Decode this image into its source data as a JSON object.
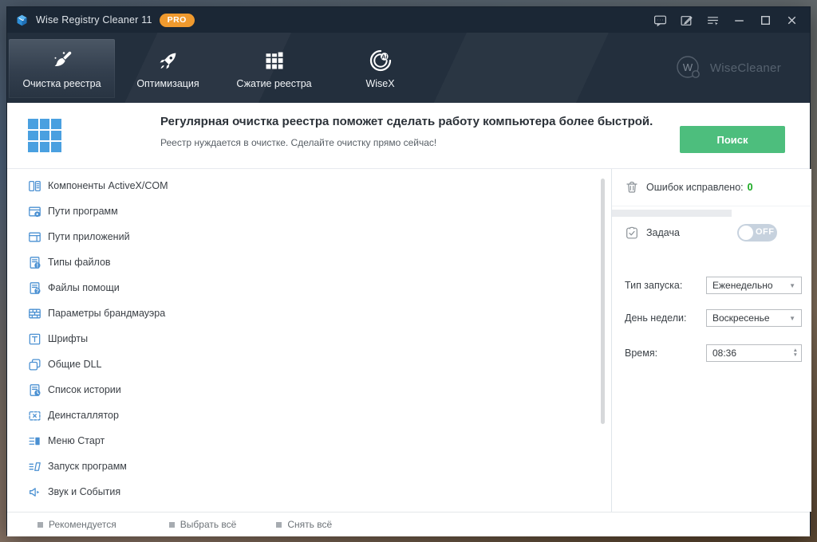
{
  "window": {
    "title": "Wise Registry Cleaner 11",
    "badge": "PRO"
  },
  "nav": {
    "tabs": [
      {
        "label": "Очистка реестра",
        "active": true
      },
      {
        "label": "Оптимизация",
        "active": false
      },
      {
        "label": "Сжатие реестра",
        "active": false
      },
      {
        "label": "WiseX",
        "active": false
      }
    ],
    "brand": "WiseCleaner"
  },
  "banner": {
    "title": "Регулярная очистка реестра поможет сделать работу компьютера более быстрой.",
    "subtitle": "Реестр нуждается в очистке. Сделайте очистку прямо сейчас!",
    "scan_button": "Поиск"
  },
  "list": {
    "items": [
      {
        "label": "Компоненты ActiveX/COM",
        "icon": "components-icon"
      },
      {
        "label": "Пути программ",
        "icon": "program-paths-icon"
      },
      {
        "label": "Пути приложений",
        "icon": "app-paths-icon"
      },
      {
        "label": "Типы файлов",
        "icon": "file-types-icon"
      },
      {
        "label": "Файлы помощи",
        "icon": "help-files-icon"
      },
      {
        "label": "Параметры брандмауэра",
        "icon": "firewall-icon"
      },
      {
        "label": "Шрифты",
        "icon": "fonts-icon"
      },
      {
        "label": "Общие DLL",
        "icon": "shared-dll-icon"
      },
      {
        "label": "Список истории",
        "icon": "history-icon"
      },
      {
        "label": "Деинсталлятор",
        "icon": "uninstaller-icon"
      },
      {
        "label": "Меню Старт",
        "icon": "start-menu-icon"
      },
      {
        "label": "Запуск программ",
        "icon": "startup-icon"
      },
      {
        "label": "Звук и События",
        "icon": "sound-icon"
      }
    ]
  },
  "panel": {
    "fixed_label": "Ошибок исправлено:",
    "fixed_value": "0",
    "task_label": "Задача",
    "toggle_state": "OFF",
    "fields": [
      {
        "label": "Тип запуска:",
        "value": "Еженедельно"
      },
      {
        "label": "День недели:",
        "value": "Воскресенье"
      },
      {
        "label": "Время:",
        "value": "08:36"
      }
    ]
  },
  "footer": {
    "items": [
      {
        "label": "Рекомендуется"
      },
      {
        "label": "Выбрать всё"
      },
      {
        "label": "Снять всё"
      }
    ]
  },
  "colors": {
    "titlebar_bg": "#1b2735",
    "nav_bg": "#232f3d",
    "accent_green": "#4dbe7d",
    "icon_blue": "#4a90d2",
    "badge_orange": "#f09a2e",
    "success_green": "#17a81f",
    "banner_icon_blue": "#4aa0e0"
  }
}
